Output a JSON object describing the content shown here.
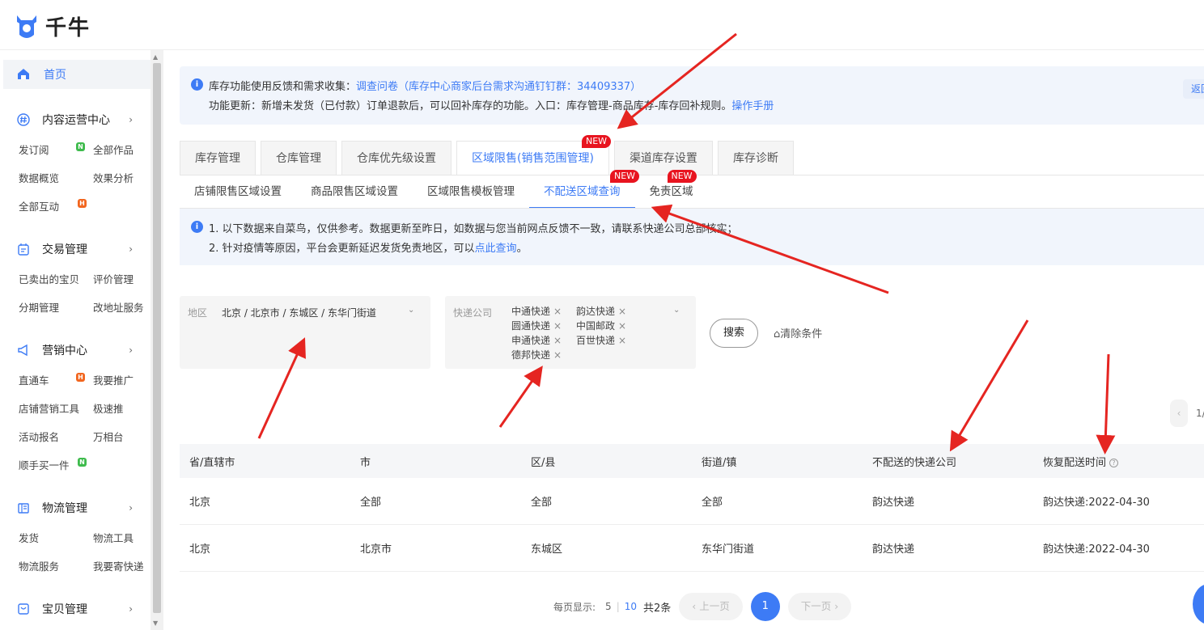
{
  "app": {
    "logo_text": "千牛",
    "brand_color": "#3d7bf5"
  },
  "sidebar": {
    "home": "首页",
    "groups": [
      {
        "title": "内容运营中心",
        "items": [
          "发订阅",
          "全部作品",
          "数据概览",
          "效果分析",
          "全部互动"
        ]
      },
      {
        "title": "交易管理",
        "items": [
          "已卖出的宝贝",
          "评价管理",
          "分期管理",
          "改地址服务"
        ]
      },
      {
        "title": "营销中心",
        "items": [
          "直通车",
          "我要推广",
          "店铺营销工具",
          "极速推",
          "活动报名",
          "万相台",
          "顺手买一件"
        ]
      },
      {
        "title": "物流管理",
        "items": [
          "发货",
          "物流工具",
          "物流服务",
          "我要寄快递"
        ]
      },
      {
        "title": "宝贝管理",
        "items": []
      }
    ],
    "badges": {
      "n": "N",
      "h": "H"
    }
  },
  "notice_top": {
    "line1_prefix": "库存功能使用反馈和需求收集：",
    "line1_link": "调查问卷（库存中心商家后台需求沟通钉钉群：34409337）",
    "line2_prefix": "功能更新：新增未发货（已付款）订单退款后，可以回补库存的功能。入口：库存管理-商品库存-库存回补规则。",
    "line2_link": "操作手册",
    "return_label": "返回旧"
  },
  "tabs": [
    "库存管理",
    "仓库管理",
    "仓库优先级设置",
    "区域限售(销售范围管理)",
    "渠道库存设置",
    "库存诊断"
  ],
  "new_badge": "NEW",
  "subtabs": [
    "店铺限售区域设置",
    "商品限售区域设置",
    "区域限售模板管理",
    "不配送区域查询",
    "免责区域"
  ],
  "notice_sub": {
    "line1": "1. 以下数据来自菜鸟，仅供参考。数据更新至昨日，如数据与您当前网点反馈不一致，请联系快递公司总部核实；",
    "line2_prefix": "2. 针对疫情等原因，平台会更新延迟发货免责地区，可以",
    "line2_link": "点此查询",
    "line2_suffix": "。"
  },
  "filters": {
    "region_label": "地区",
    "region_value": "北京 / 北京市 / 东城区 / 东华门街道",
    "express_label": "快递公司",
    "express_tags": [
      "中通快递",
      "韵达快递",
      "圆通快递",
      "中国邮政",
      "申通快递",
      "百世快递",
      "德邦快递"
    ],
    "search_button": "搜索",
    "clear_button": "清除条件"
  },
  "mini_pager": {
    "prev": "‹",
    "text": "1/"
  },
  "table": {
    "headers": [
      "省/直辖市",
      "市",
      "区/县",
      "街道/镇",
      "不配送的快递公司",
      "恢复配送时间"
    ],
    "rows": [
      [
        "北京",
        "全部",
        "全部",
        "全部",
        "韵达快递",
        "韵达快递:2022-04-30"
      ],
      [
        "北京",
        "北京市",
        "东城区",
        "东华门街道",
        "韵达快递",
        "韵达快递:2022-04-30"
      ]
    ]
  },
  "pagination": {
    "per_page_label": "每页显示:",
    "sizes": [
      "5",
      "10"
    ],
    "selected_size": "10",
    "total": "共2条",
    "prev": "‹ 上一页",
    "current": "1",
    "next": "下一页 ›"
  }
}
